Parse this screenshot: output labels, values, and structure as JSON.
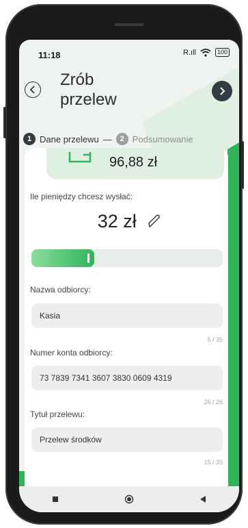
{
  "status_bar": {
    "time": "11:18",
    "signal": "R.ıll",
    "wifi": "wifi",
    "battery": "100"
  },
  "header": {
    "title_line1": "Zrób",
    "title_line2": "przelew"
  },
  "steps": [
    {
      "number": "1",
      "label": "Dane przelewu",
      "active": true
    },
    {
      "number": "2",
      "label": "Podsumowanie",
      "active": false
    }
  ],
  "step_separator": "—",
  "balance": {
    "amount": "96,88 zł"
  },
  "amount_section": {
    "label": "Ile pieniędzy chcesz wysłać:",
    "value": "32 zł",
    "slider_fraction": 0.33
  },
  "fields": {
    "recipient_name": {
      "label": "Nazwa odbiorcy:",
      "value": "Kasia",
      "counter": "5 / 35"
    },
    "account_number": {
      "label": "Numer konta odbiorcy:",
      "value": "73 7839 7341 3607 3830 0609 4319",
      "counter": "26 / 26"
    },
    "transfer_title": {
      "label": "Tytuł przelewu:",
      "value": "Przelew środków",
      "counter": "15 / 35"
    }
  },
  "colors": {
    "accent": "#2fb45a",
    "dark": "#333c43",
    "background": "#eef3ef"
  },
  "icons": {
    "back": "chevron-left-icon",
    "next": "chevron-right-icon",
    "edit": "pencil-icon"
  }
}
